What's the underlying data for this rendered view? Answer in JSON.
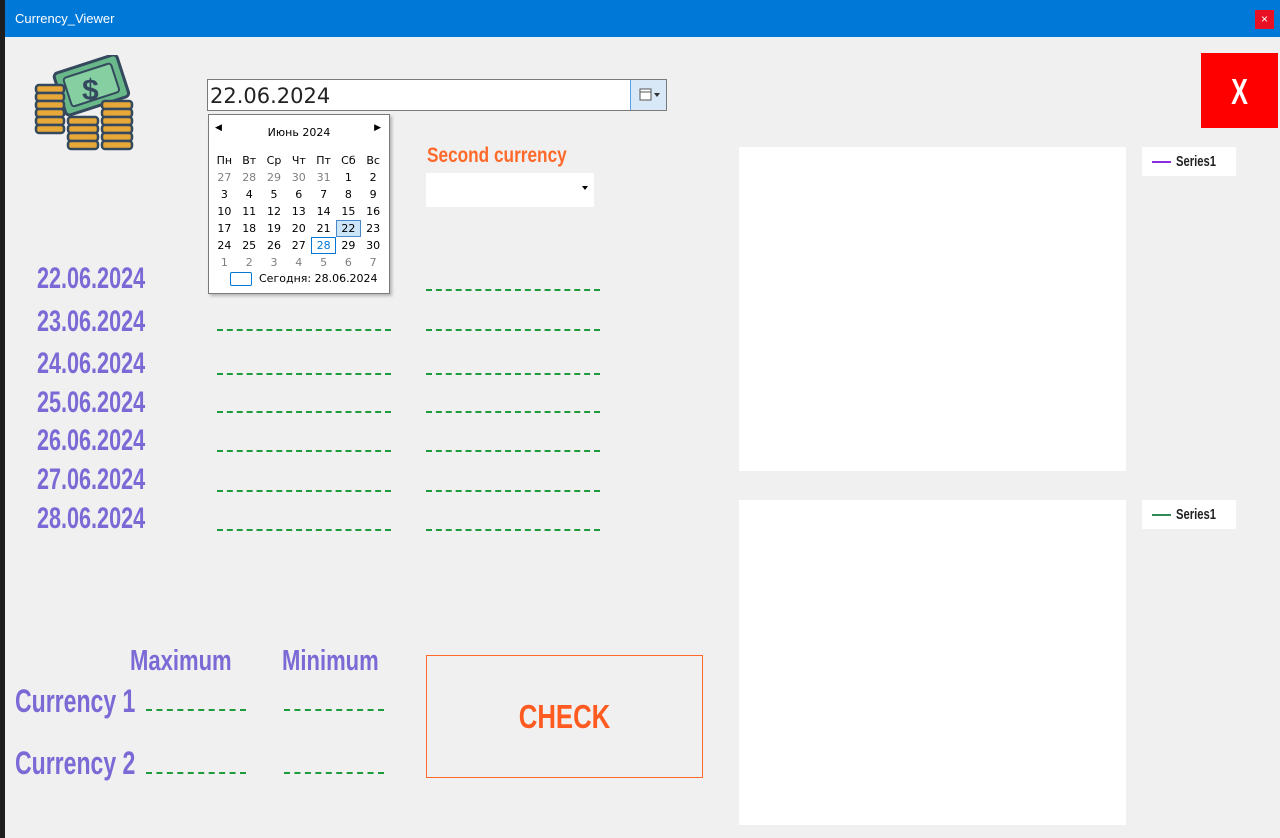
{
  "window": {
    "title": "Currency_Viewer",
    "sys_close": "×"
  },
  "date_picker": {
    "value": "22.06.2024"
  },
  "calendar": {
    "month_label": "Июнь 2024",
    "weekdays": [
      "Пн",
      "Вт",
      "Ср",
      "Чт",
      "Пт",
      "Сб",
      "Вс"
    ],
    "weeks": [
      [
        "27",
        "28",
        "29",
        "30",
        "31",
        "1",
        "2"
      ],
      [
        "3",
        "4",
        "5",
        "6",
        "7",
        "8",
        "9"
      ],
      [
        "10",
        "11",
        "12",
        "13",
        "14",
        "15",
        "16"
      ],
      [
        "17",
        "18",
        "19",
        "20",
        "21",
        "22",
        "23"
      ],
      [
        "24",
        "25",
        "26",
        "27",
        "28",
        "29",
        "30"
      ],
      [
        "1",
        "2",
        "3",
        "4",
        "5",
        "6",
        "7"
      ]
    ],
    "selected": "22",
    "today": "28",
    "today_label": "Сегодня: 28.06.2024"
  },
  "second_currency": {
    "label": "Second currency",
    "value": ""
  },
  "dates": [
    "22.06.2024",
    "23.06.2024",
    "24.06.2024",
    "25.06.2024",
    "26.06.2024",
    "27.06.2024",
    "28.06.2024"
  ],
  "stats": {
    "max_label": "Maximum",
    "min_label": "Minimum",
    "currency1_label": "Currency 1",
    "currency2_label": "Currency 2"
  },
  "check_button": {
    "label": "CHECK"
  },
  "exit_button": {
    "label": "X"
  },
  "charts": [
    {
      "legend": "Series1",
      "color": "#8a2be2"
    },
    {
      "legend": "Series1",
      "color": "#2e8b57"
    }
  ],
  "colors": {
    "accent_purple": "#7b6ad6",
    "accent_orange": "#ff6a2a",
    "dash_green": "#1e9c3c",
    "title_blue": "#0078d7",
    "exit_red": "#ff0000"
  }
}
